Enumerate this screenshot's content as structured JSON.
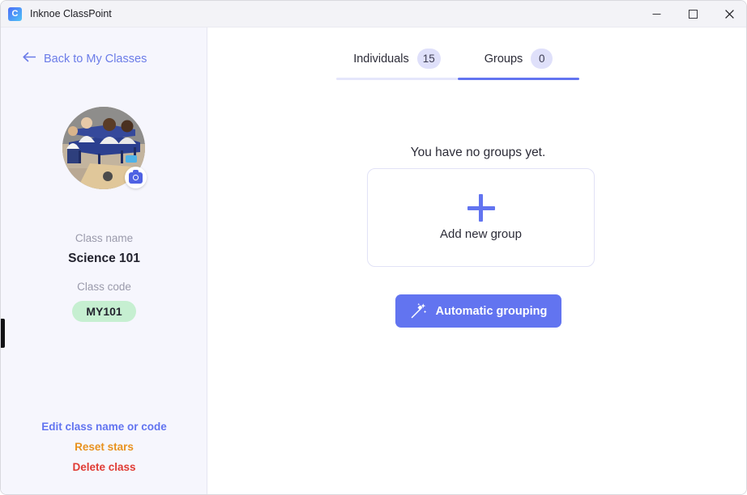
{
  "window": {
    "title": "Inknoe ClassPoint",
    "app_icon": "classpoint-logo-icon",
    "controls": {
      "minimize": "minimize-icon",
      "maximize": "maximize-icon",
      "close": "close-icon"
    }
  },
  "sidebar": {
    "back_link": "Back to My Classes",
    "back_icon": "arrow-left-icon",
    "avatar_alt": "class-photo",
    "camera_button": "camera-icon",
    "class_name_label": "Class name",
    "class_name_value": "Science 101",
    "class_code_label": "Class code",
    "class_code_value": "MY101",
    "actions": [
      {
        "label": "Edit class name or code",
        "color": "#6274f0"
      },
      {
        "label": "Reset stars",
        "color": "#e8921f"
      },
      {
        "label": "Delete class",
        "color": "#e03b34"
      }
    ]
  },
  "main": {
    "tabs": [
      {
        "label": "Individuals",
        "count": "15",
        "active": false
      },
      {
        "label": "Groups",
        "count": "0",
        "active": true
      }
    ],
    "empty_message": "You have no groups yet.",
    "add_card": {
      "icon": "plus-icon",
      "label": "Add new group"
    },
    "automatic_grouping": {
      "label": "Automatic grouping",
      "icon": "magic-wand-icon"
    }
  },
  "colors": {
    "accent": "#6274f0",
    "badge_bg": "#dfe0fa",
    "code_badge_bg": "#c6efd1",
    "sidebar_bg": "#f6f6fd",
    "titlebar_bg": "#f3f3f7"
  }
}
